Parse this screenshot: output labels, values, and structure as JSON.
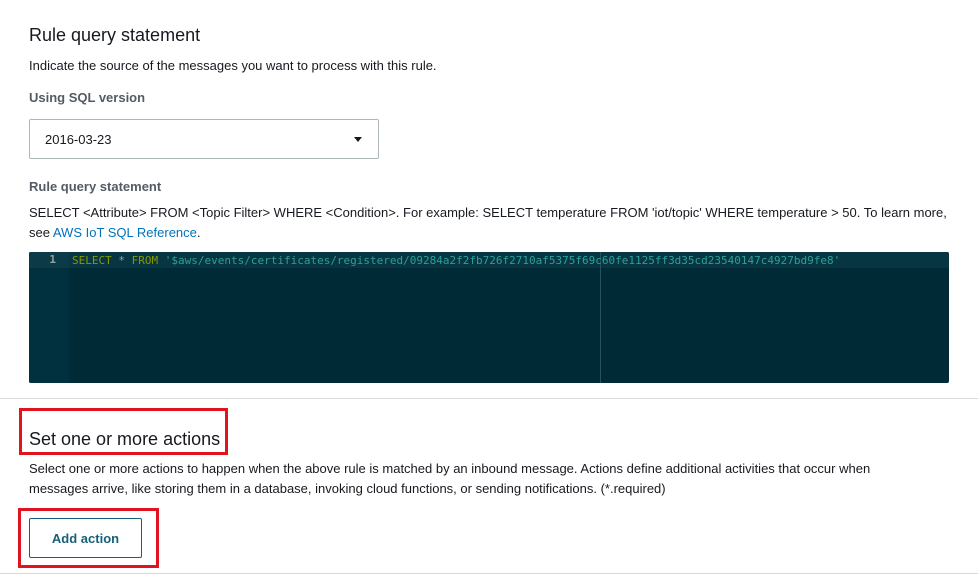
{
  "rule_query": {
    "title": "Rule query statement",
    "description": "Indicate the source of the messages you want to process with this rule.",
    "sql_version_label": "Using SQL version",
    "sql_version_value": "2016-03-23",
    "statement_label": "Rule query statement",
    "help_text": "SELECT <Attribute> FROM <Topic Filter> WHERE <Condition>. For example: SELECT temperature FROM 'iot/topic' WHERE temperature > 50. To learn more, see ",
    "help_link": "AWS IoT SQL Reference",
    "help_suffix": "."
  },
  "editor": {
    "line_number": "1",
    "kw_select": "SELECT",
    "star": " * ",
    "kw_from": "FROM",
    "space": " ",
    "string": "'$aws/events/certificates/registered/09284a2f2fb726f2710af5375f69c60fe1125ff3d35cd23540147c4927bd9fe8'"
  },
  "actions": {
    "title": "Set one or more actions",
    "description": "Select one or more actions to happen when the above rule is matched by an inbound message. Actions define additional activities that occur when messages arrive, like storing them in a database, invoking cloud functions, or sending notifications. (*.required)",
    "add_button": "Add action"
  },
  "colors": {
    "highlight": "#e0141e",
    "link": "#0073bb",
    "editor_bg": "#002b36",
    "button_text": "#16607a"
  },
  "icons": {
    "dropdown": "caret-down-icon"
  }
}
